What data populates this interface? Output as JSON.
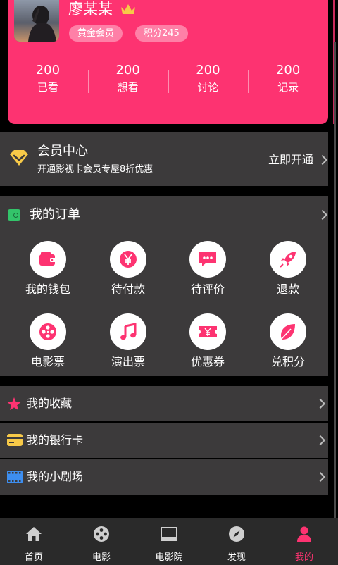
{
  "profile": {
    "username": "廖某某",
    "badge_level": "黄金会员",
    "badge_points": "积分245",
    "stats": [
      {
        "num": "200",
        "label": "已看"
      },
      {
        "num": "200",
        "label": "想看"
      },
      {
        "num": "200",
        "label": "讨论"
      },
      {
        "num": "200",
        "label": "记录"
      }
    ]
  },
  "vip": {
    "title": "会员中心",
    "subtitle": "开通影视卡会员专屋8折优惠",
    "action": "立即开通"
  },
  "orders": {
    "title": "我的订单",
    "items": [
      {
        "label": "我的钱包",
        "icon": "wallet-icon"
      },
      {
        "label": "待付款",
        "icon": "yen-icon"
      },
      {
        "label": "待评价",
        "icon": "comment-icon"
      },
      {
        "label": "退款",
        "icon": "rocket-icon"
      },
      {
        "label": "电影票",
        "icon": "film-reel-icon"
      },
      {
        "label": "演出票",
        "icon": "music-note-icon"
      },
      {
        "label": "优惠券",
        "icon": "coupon-icon"
      },
      {
        "label": "兑积分",
        "icon": "leaf-icon"
      }
    ]
  },
  "lists": [
    {
      "label": "我的收藏",
      "icon": "star-icon"
    },
    {
      "label": "我的银行卡",
      "icon": "bank-card-icon"
    },
    {
      "label": "我的小剧场",
      "icon": "film-strip-icon"
    }
  ],
  "tabs": [
    {
      "label": "首页",
      "icon": "home-icon",
      "active": false
    },
    {
      "label": "电影",
      "icon": "film-reel-icon",
      "active": false
    },
    {
      "label": "电影院",
      "icon": "cinema-icon",
      "active": false
    },
    {
      "label": "发现",
      "icon": "compass-icon",
      "active": false
    },
    {
      "label": "我的",
      "icon": "user-icon",
      "active": true
    }
  ],
  "colors": {
    "accent": "#fd3371",
    "panel": "#3c3a3b",
    "tabbar": "#2a2a2a",
    "gold": "#f7c948"
  }
}
